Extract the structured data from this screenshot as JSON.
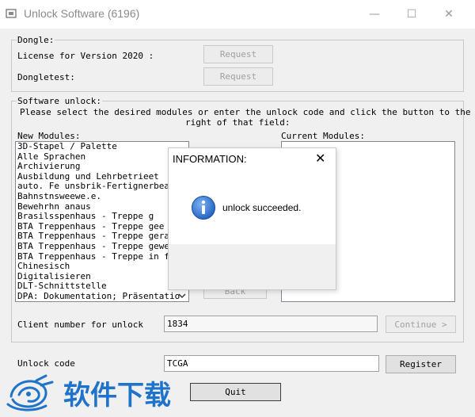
{
  "window": {
    "title": "Unlock Software (6196)",
    "controls": {
      "minimize": "—",
      "maximize": "☐",
      "close": "✕"
    }
  },
  "dongle": {
    "legend": "Dongle:",
    "license_label": "License for Version 2020 :",
    "dongletest_label": "Dongletest:",
    "request_button_1": "Request",
    "request_button_2": "Request"
  },
  "software_unlock": {
    "legend": "Software unlock:",
    "instructions_line1": "Please select the desired modules or enter the unlock code and click the button to the",
    "instructions_line2": "right of that field:",
    "new_modules_label": "New Modules:",
    "current_modules_label": "Current Modules:",
    "new_modules": [
      "3D-Stapel / Palette",
      "Alle Sprachen",
      "Archivierung",
      "Ausbildung und Lehrbetrieet",
      "auto. Fe unsbrik-Fertignerbeat",
      "Bahnstnsweewe.e.",
      "Bewehrhn anaus",
      "Brasilsspenhaus - Treppe g",
      "BTA Treppenhaus - Treppe gee",
      "BTA Treppenhaus - Treppe gerad",
      "BTA Treppenhaus - Treppe gewen",
      "BTA Treppenhaus - Treppe in fe",
      "Chinesisch",
      "Digitalisieren",
      "DLT-Schnittstelle",
      "DPA: Dokumentation; Präsentatio"
    ],
    "back_button": "Back",
    "client_number_label": "Client number for unlock",
    "client_number_value": "1834",
    "continue_button": "Continue >"
  },
  "unlock_code": {
    "label": "Unlock code",
    "value": "TCGA",
    "register_button": "Register"
  },
  "quit_button": "Quit",
  "dialog": {
    "title": "INFORMATION:",
    "close": "✕",
    "message": "unlock succeeded.",
    "icon": "info-icon"
  },
  "watermark": {
    "text": "软件下载"
  },
  "colors": {
    "window_bg": "#f0f0f0",
    "info_icon": "#2a6fd6",
    "watermark_blue": "#1f73c9"
  }
}
